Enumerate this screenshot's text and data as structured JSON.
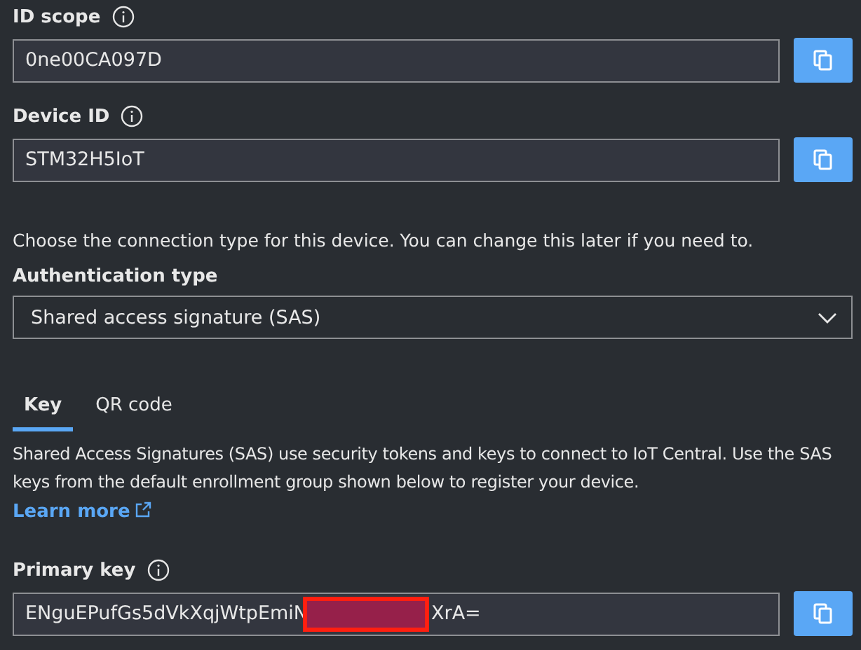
{
  "fields": [
    {
      "label": "ID scope",
      "value": "0ne00CA097D"
    },
    {
      "label": "Device ID",
      "value": "STM32H5IoT"
    }
  ],
  "connection_hint": "Choose the connection type for this device. You can change this later if you need to.",
  "authentication": {
    "label": "Authentication type",
    "value": "Shared access signature (SAS)"
  },
  "tabs": [
    {
      "label": "Key",
      "selected": true
    },
    {
      "label": "QR code",
      "selected": false
    }
  ],
  "description": "Shared Access Signatures (SAS) use security tokens and keys to connect to IoT Central. Use the SAS keys from the default enrollment group shown below to register your device.",
  "learn_more": "Learn more",
  "primary_key": {
    "label": "Primary key",
    "value_start": "ENguEPufGs5dVkXqjWtpEmiN",
    "value_end": "XrA=",
    "redacted": true
  }
}
